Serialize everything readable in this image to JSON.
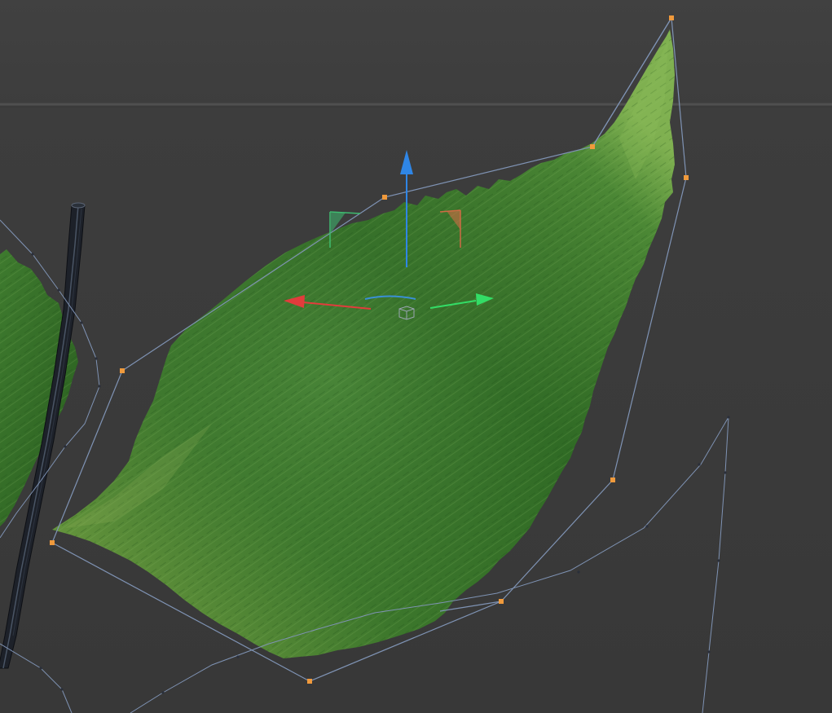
{
  "viewport": {
    "background": "#3a3a3a",
    "background_upper": "#404040",
    "horizon_line_color": "#4d4d4d"
  },
  "scene": {
    "leaf_colors": [
      "#2f6a25",
      "#3f7f2f",
      "#5a9a45",
      "#1f4e1a"
    ],
    "cage_line_color": "#7f93b4",
    "control_point_color": "#f09a3c",
    "stem_color": "#1b1f27",
    "stem_highlight": "#4a5568"
  },
  "gizmo": {
    "x_axis_color": "#e23c3c",
    "y_axis_color": "#33dd66",
    "z_axis_color": "#2f86e6",
    "rotation_arc_color": "#3a8fd6",
    "plane_xz_color": "#d06a44",
    "plane_yz_color": "#3ebc70",
    "center_icon": "cube-icon"
  }
}
